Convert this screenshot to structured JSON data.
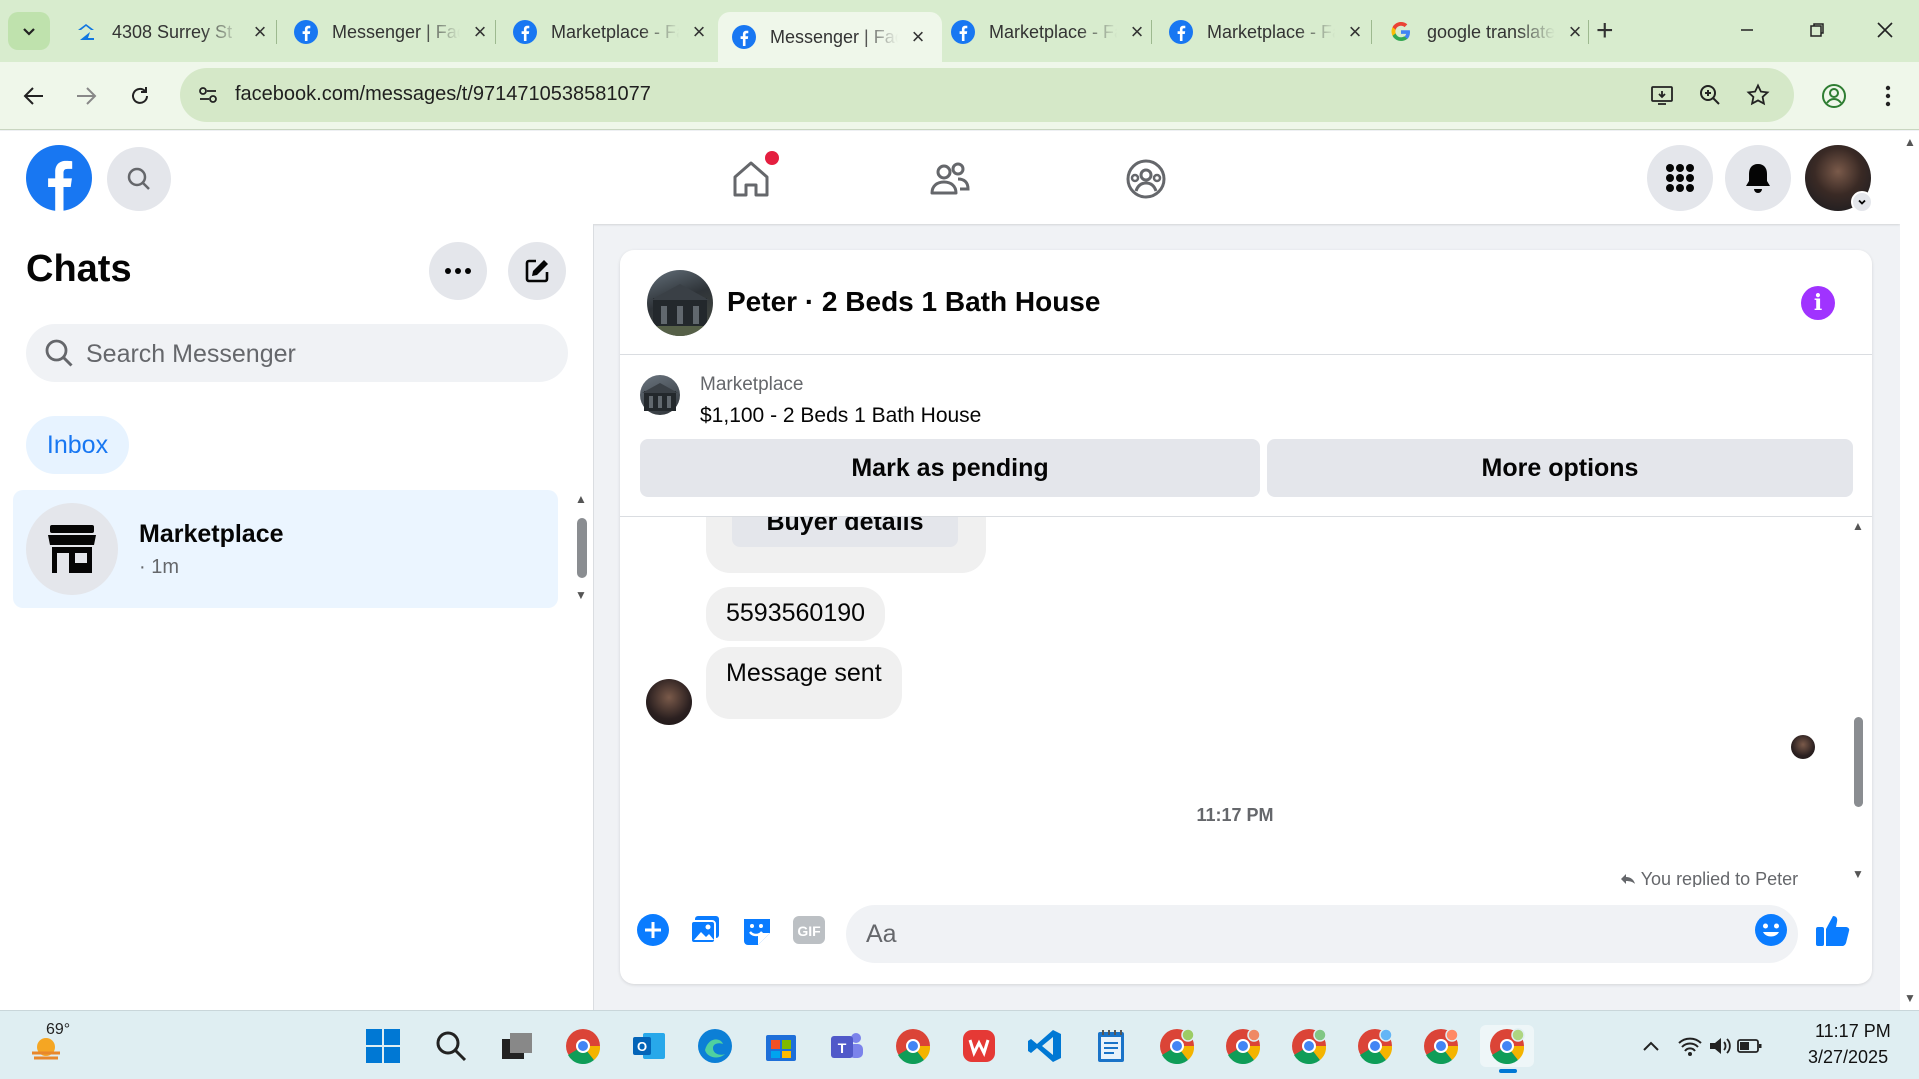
{
  "browser": {
    "tabs": [
      {
        "title": "4308 Surrey St",
        "icon": "zillow-icon"
      },
      {
        "title": "Messenger | Facebook",
        "icon": "facebook-icon"
      },
      {
        "title": "Marketplace - Facebook",
        "icon": "facebook-icon"
      },
      {
        "title": "Messenger | Facebook",
        "icon": "facebook-icon",
        "active": true
      },
      {
        "title": "Marketplace - Facebook",
        "icon": "facebook-icon"
      },
      {
        "title": "Marketplace - Facebook",
        "icon": "facebook-icon"
      },
      {
        "title": "google translate",
        "icon": "google-icon"
      }
    ],
    "url": "facebook.com/messages/t/9714710538581077"
  },
  "sidebar": {
    "title": "Chats",
    "search_placeholder": "Search Messenger",
    "filter_label": "Inbox",
    "chats": [
      {
        "name": "Marketplace",
        "time": "· 1m"
      }
    ]
  },
  "conversation": {
    "title": "Peter · 2 Beds 1 Bath House",
    "listing": {
      "label": "Marketplace",
      "title": "$1,100 - 2 Beds 1 Bath House",
      "pending_button": "Mark as pending",
      "more_button": "More options"
    },
    "messages": {
      "buyer_details_button": "Buyer details",
      "phone": "5593560190",
      "sent": "Message sent",
      "timestamp": "11:17 PM",
      "replied_note": "You replied to Peter"
    },
    "composer_placeholder": "Aa"
  },
  "taskbar": {
    "weather_temp": "69°",
    "time": "11:17 PM",
    "date": "3/27/2025"
  },
  "colors": {
    "facebook_blue": "#1877f2",
    "info_purple": "#a033ff",
    "notification_red": "#e41e3f"
  }
}
